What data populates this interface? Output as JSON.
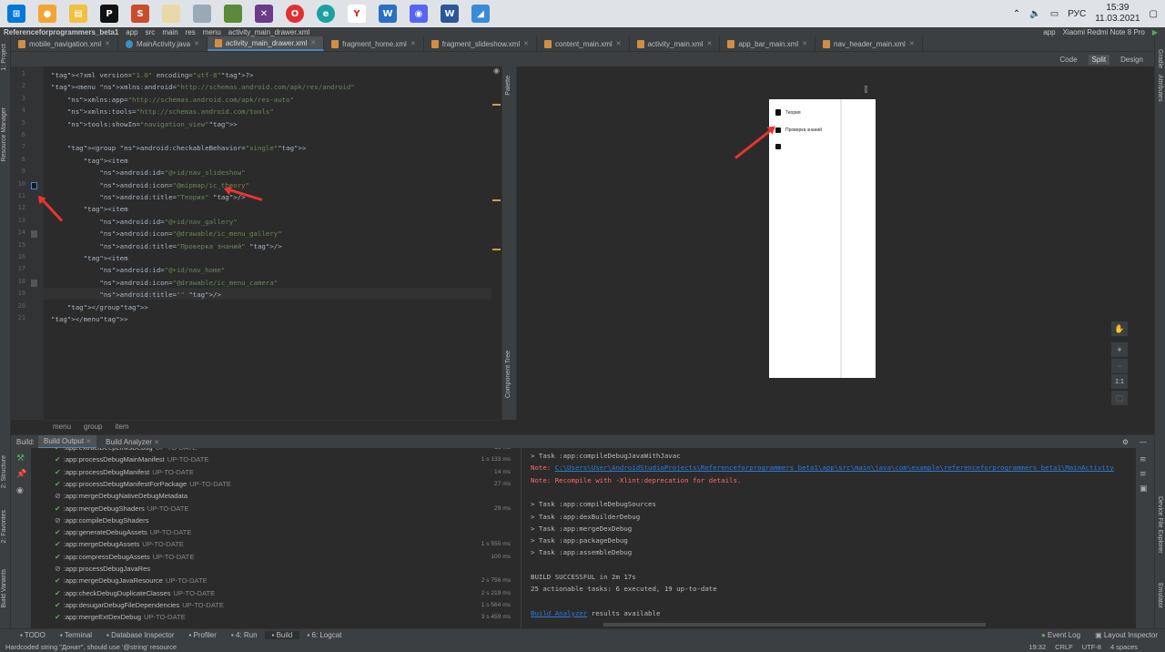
{
  "taskbar": {
    "clock_time": "15:39",
    "clock_date": "11.03.2021",
    "lang": "РУС"
  },
  "navbar": {
    "items": [
      "Referenceforprogrammers_beta1",
      "app",
      "src",
      "main",
      "res",
      "menu",
      "activity_main_drawer.xml"
    ],
    "run_config": "app",
    "device": "Xiaomi Redmi Note 8 Pro"
  },
  "tabs": [
    "mobile_navigation.xml",
    "MainActivity.java",
    "activity_main_drawer.xml",
    "fragment_home.xml",
    "fragment_slideshow.xml",
    "content_main.xml",
    "activity_main.xml",
    "app_bar_main.xml",
    "nav_header_main.xml"
  ],
  "active_tab": 2,
  "view_modes": [
    "Code",
    "Split",
    "Design"
  ],
  "left_strip": [
    "1: Project",
    "Resource Manager",
    "2: Structure",
    "2: Favorites",
    "Build Variants"
  ],
  "right_strip": [
    "Gradle",
    "Attributes",
    "Device File Explorer",
    "Emulator"
  ],
  "editor": {
    "line_numbers": [
      "1",
      "2",
      "3",
      "4",
      "5",
      "6",
      "7",
      "8",
      "9",
      "10",
      "11",
      "12",
      "13",
      "14",
      "15",
      "16",
      "17",
      "18",
      "19",
      "20",
      "21"
    ],
    "lines": [
      {
        "t": "<?xml version=\"1.0\" encoding=\"utf-8\"?>"
      },
      {
        "t": "<menu xmlns:android=\"http://schemas.android.com/apk/res/android\""
      },
      {
        "t": "    xmlns:app=\"http://schemas.android.com/apk/res-auto\""
      },
      {
        "t": "    xmlns:tools=\"http://schemas.android.com/tools\""
      },
      {
        "t": "    tools:showIn=\"navigation_view\">"
      },
      {
        "t": ""
      },
      {
        "t": "    <group android:checkableBehavior=\"single\">"
      },
      {
        "t": "        <item"
      },
      {
        "t": "            android:id=\"@+id/nav_slideshow\""
      },
      {
        "t": "            android:icon=\"@mipmap/ic_theory\""
      },
      {
        "t": "            android:title=\"Теория\" />"
      },
      {
        "t": "        <item"
      },
      {
        "t": "            android:id=\"@+id/nav_gallery\""
      },
      {
        "t": "            android:icon=\"@drawable/ic_menu_gallery\""
      },
      {
        "t": "            android:title=\"Проверка знаний\" />"
      },
      {
        "t": "        <item"
      },
      {
        "t": "            android:id=\"@+id/nav_home\""
      },
      {
        "t": "            android:icon=\"@drawable/ic_menu_camera\""
      },
      {
        "t": "            android:title=\"\" />"
      },
      {
        "t": "    </group>"
      },
      {
        "t": "</menu>"
      }
    ],
    "breadcrumb": [
      "menu",
      "group",
      "item"
    ]
  },
  "palette_labels": [
    "Palette",
    "Component Tree"
  ],
  "preview_menu": [
    "Теория",
    "Проверка знаний",
    ""
  ],
  "zoom_buttons": [
    "+",
    "−",
    "1:1"
  ],
  "build": {
    "label": "Build:",
    "tabs": [
      "Build Output",
      "Build Analyzer"
    ],
    "tree": [
      {
        "task": ":app:extractDeepLinksDebug",
        "status": "UP-TO-DATE",
        "time": "16 ms",
        "icon": "check"
      },
      {
        "task": ":app:processDebugMainManifest",
        "status": "UP-TO-DATE",
        "time": "1 s 133 ms",
        "icon": "check"
      },
      {
        "task": ":app:processDebugManifest",
        "status": "UP-TO-DATE",
        "time": "14 ms",
        "icon": "check"
      },
      {
        "task": ":app:processDebugManifestForPackage",
        "status": "UP-TO-DATE",
        "time": "27 ms",
        "icon": "check"
      },
      {
        "task": ":app:mergeDebugNativeDebugMetadata",
        "status": "",
        "time": "",
        "icon": "skip"
      },
      {
        "task": ":app:mergeDebugShaders",
        "status": "UP-TO-DATE",
        "time": "29 ms",
        "icon": "check"
      },
      {
        "task": ":app:compileDebugShaders",
        "status": "",
        "time": "",
        "icon": "skip"
      },
      {
        "task": ":app:generateDebugAssets",
        "status": "UP-TO-DATE",
        "time": "",
        "icon": "check"
      },
      {
        "task": ":app:mergeDebugAssets",
        "status": "UP-TO-DATE",
        "time": "1 s 555 ms",
        "icon": "check"
      },
      {
        "task": ":app:compressDebugAssets",
        "status": "UP-TO-DATE",
        "time": "100 ms",
        "icon": "check"
      },
      {
        "task": ":app:processDebugJavaRes",
        "status": "",
        "time": "",
        "icon": "skip"
      },
      {
        "task": ":app:mergeDebugJavaResource",
        "status": "UP-TO-DATE",
        "time": "2 s 756 ms",
        "icon": "check"
      },
      {
        "task": ":app:checkDebugDuplicateClasses",
        "status": "UP-TO-DATE",
        "time": "2 s 219 ms",
        "icon": "check"
      },
      {
        "task": ":app:desugarDebugFileDependencies",
        "status": "UP-TO-DATE",
        "time": "1 s 564 ms",
        "icon": "check"
      },
      {
        "task": ":app:mergeExtDexDebug",
        "status": "UP-TO-DATE",
        "time": "3 s 459 ms",
        "icon": "check"
      }
    ],
    "console": [
      {
        "t": "> Task :app:compileDebugJavaWithJavac",
        "k": ""
      },
      {
        "t": "Note: ",
        "k": "err",
        "link": "C:\\Users\\User\\AndroidStudioProjects\\Referenceforprogrammers_beta1\\app\\src\\main\\java\\com\\example\\referenceforprogrammers_beta1\\MainActivity"
      },
      {
        "t": "Note: Recompile with -Xlint:deprecation for details.",
        "k": "err"
      },
      {
        "t": "",
        "k": ""
      },
      {
        "t": "> Task :app:compileDebugSources",
        "k": ""
      },
      {
        "t": "> Task :app:dexBuilderDebug",
        "k": ""
      },
      {
        "t": "> Task :app:mergeDexDebug",
        "k": ""
      },
      {
        "t": "> Task :app:packageDebug",
        "k": ""
      },
      {
        "t": "> Task :app:assembleDebug",
        "k": ""
      },
      {
        "t": "",
        "k": ""
      },
      {
        "t": "BUILD SUCCESSFUL in 2m 17s",
        "k": ""
      },
      {
        "t": "25 actionable tasks: 6 executed, 19 up-to-date",
        "k": ""
      },
      {
        "t": "",
        "k": ""
      },
      {
        "t": " results available",
        "k": "",
        "prelink": "Build Analyzer"
      }
    ]
  },
  "tool_tabs": [
    "TODO",
    "Terminal",
    "Database Inspector",
    "Profiler",
    "4: Run",
    "Build",
    "6: Logcat"
  ],
  "tool_tabs_right": [
    "Event Log",
    "Layout Inspector"
  ],
  "status": {
    "message": "Hardcoded string \"Донат\", should use '@string' resource",
    "pos": "19:32",
    "sep": "CRLF",
    "enc": "UTF-8",
    "indent": "4 spaces"
  }
}
